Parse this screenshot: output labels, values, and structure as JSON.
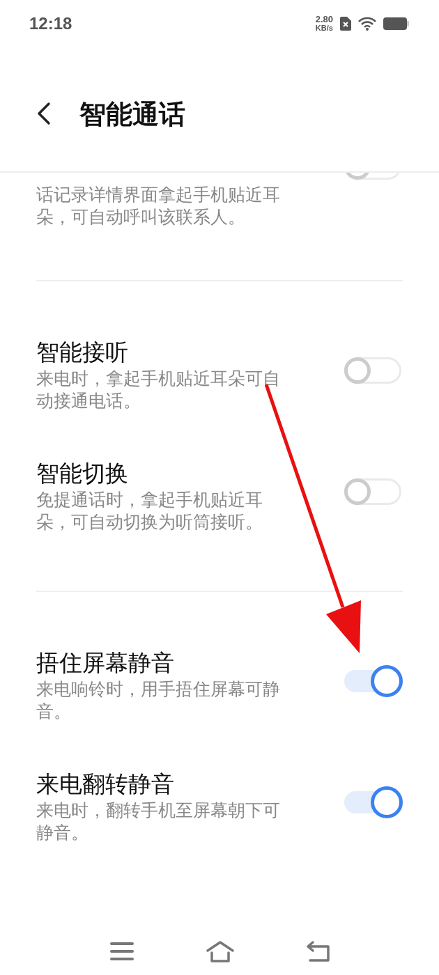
{
  "status_bar": {
    "time": "12:18",
    "net_speed": "2.80",
    "net_unit": "KB/s"
  },
  "header": {
    "title": "智能通话"
  },
  "partial_item": {
    "description": "话记录详情界面拿起手机贴近耳朵，可自动呼叫该联系人。",
    "on": false
  },
  "groups": [
    {
      "items": [
        {
          "title": "智能接听",
          "description": "来电时，拿起手机贴近耳朵可自动接通电话。",
          "on": false
        },
        {
          "title": "智能切换",
          "description": "免提通话时，拿起手机贴近耳朵，可自动切换为听筒接听。",
          "on": false
        }
      ]
    },
    {
      "items": [
        {
          "title": "捂住屏幕静音",
          "description": "来电响铃时，用手捂住屏幕可静音。",
          "on": true
        },
        {
          "title": "来电翻转静音",
          "description": "来电时，翻转手机至屏幕朝下可静音。",
          "on": true
        }
      ]
    }
  ]
}
